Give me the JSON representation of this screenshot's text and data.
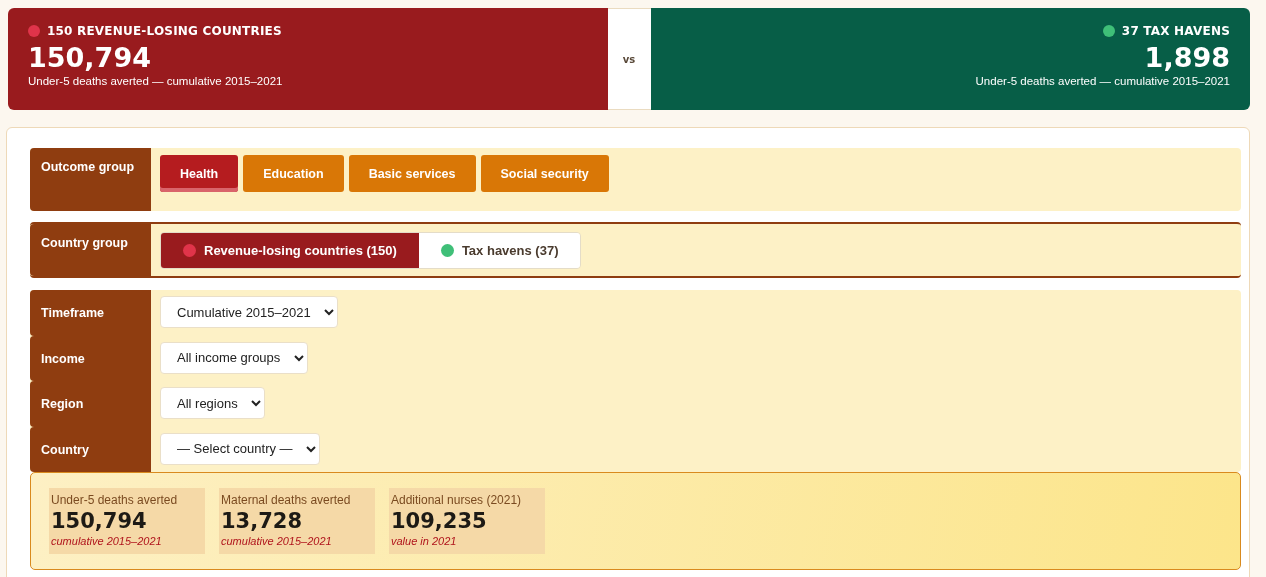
{
  "comparison": {
    "left": {
      "title": "150 REVENUE-LOSING COUNTRIES",
      "color": "#e0344a",
      "value": "150,794",
      "caption": "Under-5 deaths averted — cumulative 2015–2021"
    },
    "divider": "vs",
    "right": {
      "title": "37 TAX HAVENS",
      "color": "#3fbf78",
      "value": "1,898",
      "caption": "Under-5 deaths averted — cumulative 2015–2021"
    }
  },
  "outcome_group": {
    "label": "Outcome group",
    "options": [
      {
        "label": "Health",
        "selected": true
      },
      {
        "label": "Education",
        "selected": false
      },
      {
        "label": "Basic services",
        "selected": false
      },
      {
        "label": "Social security",
        "selected": false
      }
    ]
  },
  "country_group": {
    "label": "Country group",
    "options": [
      {
        "label": "Revenue-losing countries (150)",
        "color": "#e0344a",
        "selected": true
      },
      {
        "label": "Tax havens (37)",
        "color": "#3fbf78",
        "selected": false
      }
    ]
  },
  "filters": [
    {
      "label": "Timeframe",
      "value": "Cumulative 2015–2021"
    },
    {
      "label": "Income",
      "value": "All income groups"
    },
    {
      "label": "Region",
      "value": "All regions"
    },
    {
      "label": "Country",
      "value": "— Select country —"
    }
  ],
  "stats": [
    {
      "label": "Under-5 deaths averted",
      "value": "150,794",
      "note": "cumulative 2015–2021"
    },
    {
      "label": "Maternal deaths averted",
      "value": "13,728",
      "note": "cumulative 2015–2021"
    },
    {
      "label": "Additional nurses (2021)",
      "value": "109,235",
      "note": "value in 2021"
    }
  ]
}
